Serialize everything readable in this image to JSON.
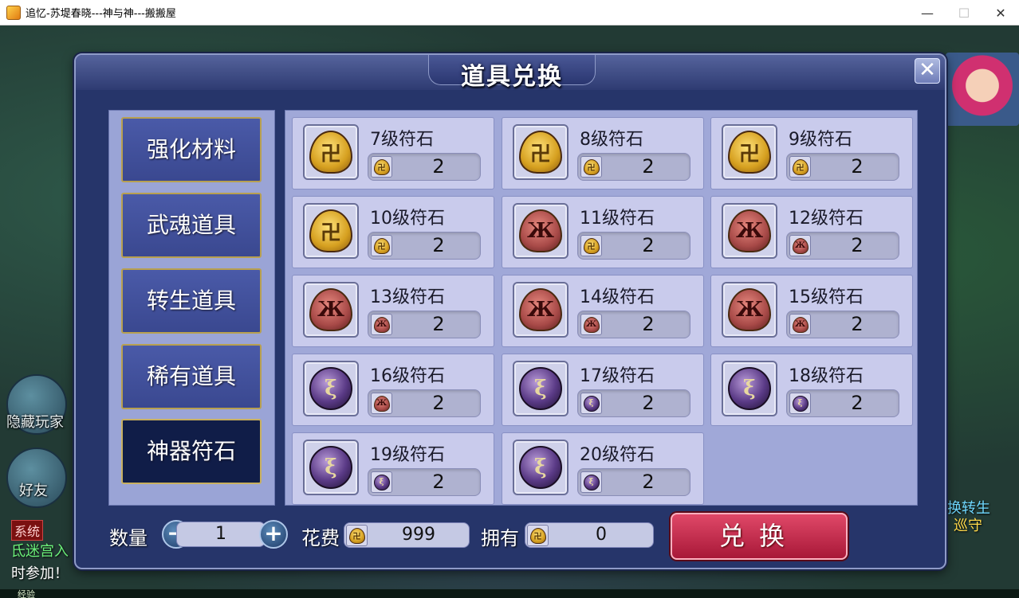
{
  "window": {
    "title": "追忆-苏堤春晓---神与神---搬搬屋",
    "minimize": "—",
    "maximize": "☐",
    "close": "✕"
  },
  "hud": {
    "hide_players": "隐藏玩家",
    "friends": "好友",
    "system_tag": "系统",
    "chat_line1": "氐迷宫入",
    "chat_line2": "时参加！",
    "right_text1": "换转生",
    "right_text2": "巡守",
    "exp_label": "经验"
  },
  "dialog": {
    "title": "道具兑换",
    "close_icon": "close-icon"
  },
  "categories": [
    {
      "label": "强化材料",
      "active": false
    },
    {
      "label": "武魂道具",
      "active": false
    },
    {
      "label": "转生道具",
      "active": false
    },
    {
      "label": "稀有道具",
      "active": false
    },
    {
      "label": "神器符石",
      "active": true
    }
  ],
  "items": [
    {
      "name": "7级符石",
      "cost": "2",
      "stone": "gold",
      "cost_stone": "gold"
    },
    {
      "name": "8级符石",
      "cost": "2",
      "stone": "gold",
      "cost_stone": "gold"
    },
    {
      "name": "9级符石",
      "cost": "2",
      "stone": "gold",
      "cost_stone": "gold"
    },
    {
      "name": "10级符石",
      "cost": "2",
      "stone": "gold",
      "cost_stone": "gold"
    },
    {
      "name": "11级符石",
      "cost": "2",
      "stone": "red",
      "cost_stone": "gold"
    },
    {
      "name": "12级符石",
      "cost": "2",
      "stone": "red",
      "cost_stone": "red"
    },
    {
      "name": "13级符石",
      "cost": "2",
      "stone": "red",
      "cost_stone": "red"
    },
    {
      "name": "14级符石",
      "cost": "2",
      "stone": "red",
      "cost_stone": "red"
    },
    {
      "name": "15级符石",
      "cost": "2",
      "stone": "red",
      "cost_stone": "red"
    },
    {
      "name": "16级符石",
      "cost": "2",
      "stone": "purple",
      "cost_stone": "red"
    },
    {
      "name": "17级符石",
      "cost": "2",
      "stone": "purple",
      "cost_stone": "purple"
    },
    {
      "name": "18级符石",
      "cost": "2",
      "stone": "purple",
      "cost_stone": "purple"
    },
    {
      "name": "19级符石",
      "cost": "2",
      "stone": "purple",
      "cost_stone": "purple"
    },
    {
      "name": "20级符石",
      "cost": "2",
      "stone": "purple",
      "cost_stone": "purple"
    }
  ],
  "stone_glyphs": {
    "gold": "卍",
    "red": "Ж",
    "purple": "ξ"
  },
  "bottom": {
    "quantity_label": "数量",
    "quantity_value": "1",
    "minus": "−",
    "plus": "+",
    "cost_label": "花费",
    "cost_value": "999",
    "own_label": "拥有",
    "own_value": "0",
    "exchange_label": "兑换"
  }
}
